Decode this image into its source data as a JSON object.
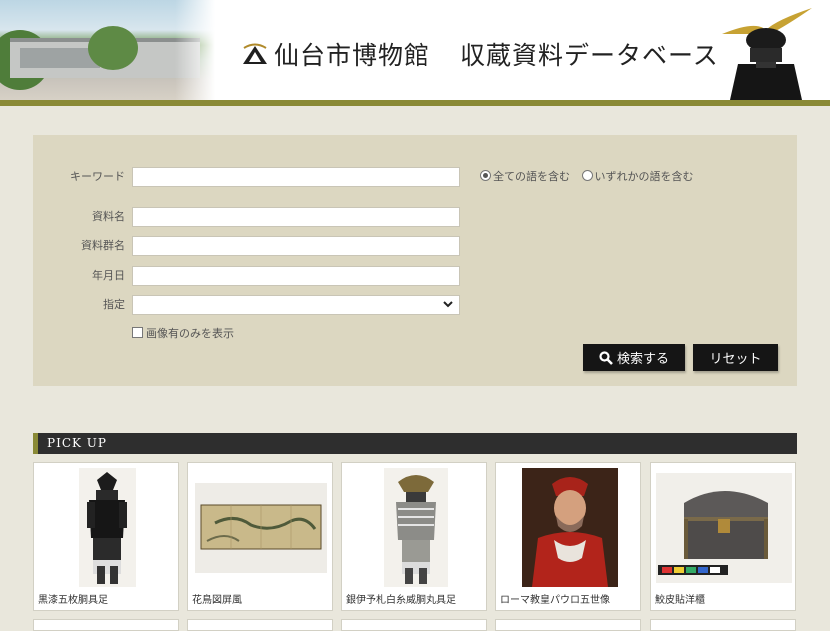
{
  "header": {
    "museum_name": "仙台市博物館",
    "database_name": "収蔵資料データベース"
  },
  "search": {
    "keyword_label": "キーワード",
    "keyword_value": "",
    "radio_all": "全ての語を含む",
    "radio_any": "いずれかの語を含む",
    "radio_selected": "all",
    "name_label": "資料名",
    "name_value": "",
    "group_label": "資料群名",
    "group_value": "",
    "date_label": "年月日",
    "date_value": "",
    "designation_label": "指定",
    "designation_value": "",
    "image_only_label": "画像有のみを表示",
    "image_only_checked": false,
    "search_button": "検索する",
    "reset_button": "リセット"
  },
  "pickup": {
    "title": "PICK UP",
    "items": [
      {
        "caption": "黒漆五枚胴具足",
        "icon": "armor-image"
      },
      {
        "caption": "花鳥図屏風",
        "icon": "folding-screen-image"
      },
      {
        "caption": "銀伊予札白糸威胴丸具足",
        "icon": "armor-image"
      },
      {
        "caption": "ローマ教皇パウロ五世像",
        "icon": "portrait-image"
      },
      {
        "caption": "鮫皮貼洋櫃",
        "icon": "chest-image"
      }
    ]
  }
}
